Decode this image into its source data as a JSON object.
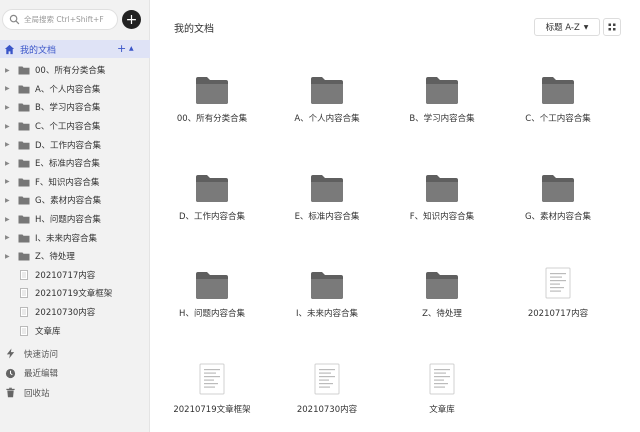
{
  "sidebar": {
    "search_placeholder": "全局搜索 Ctrl+Shift+F",
    "new_button": "+",
    "root": {
      "label": "我的文档",
      "add": "+",
      "caret": "▲"
    },
    "items": [
      {
        "label": "00、所有分类合集",
        "type": "folder"
      },
      {
        "label": "A、个人内容合集",
        "type": "folder"
      },
      {
        "label": "B、学习内容合集",
        "type": "folder"
      },
      {
        "label": "C、个工内容合集",
        "type": "folder"
      },
      {
        "label": "D、工作内容合集",
        "type": "folder"
      },
      {
        "label": "E、标准内容合集",
        "type": "folder"
      },
      {
        "label": "F、知识内容合集",
        "type": "folder"
      },
      {
        "label": "G、素材内容合集",
        "type": "folder"
      },
      {
        "label": "H、问题内容合集",
        "type": "folder"
      },
      {
        "label": "I、未来内容合集",
        "type": "folder"
      },
      {
        "label": "Z、待处理",
        "type": "folder"
      },
      {
        "label": "20210717内容",
        "type": "doc"
      },
      {
        "label": "20210719文章框架",
        "type": "doc"
      },
      {
        "label": "20210730内容",
        "type": "doc"
      },
      {
        "label": "文章库",
        "type": "doc"
      }
    ],
    "bottom": [
      {
        "label": "快速访问",
        "icon": "lightning-icon"
      },
      {
        "label": "最近编辑",
        "icon": "clock-icon"
      },
      {
        "label": "回收站",
        "icon": "trash-icon"
      }
    ]
  },
  "main": {
    "title": "我的文档",
    "sort_label": "标题 A-Z",
    "cards": [
      {
        "label": "00、所有分类合集",
        "type": "folder"
      },
      {
        "label": "A、个人内容合集",
        "type": "folder"
      },
      {
        "label": "B、学习内容合集",
        "type": "folder"
      },
      {
        "label": "C、个工内容合集",
        "type": "folder"
      },
      {
        "label": "D、工作内容合集",
        "type": "folder"
      },
      {
        "label": "E、标准内容合集",
        "type": "folder"
      },
      {
        "label": "F、知识内容合集",
        "type": "folder"
      },
      {
        "label": "G、素材内容合集",
        "type": "folder"
      },
      {
        "label": "H、问题内容合集",
        "type": "folder"
      },
      {
        "label": "I、未来内容合集",
        "type": "folder"
      },
      {
        "label": "Z、待处理",
        "type": "folder"
      },
      {
        "label": "20210717内容",
        "type": "doc"
      },
      {
        "label": "20210719文章框架",
        "type": "doc"
      },
      {
        "label": "20210730内容",
        "type": "doc"
      },
      {
        "label": "文章库",
        "type": "doc"
      }
    ]
  },
  "colors": {
    "accent": "#3a55c8",
    "highlight": "#dfe3f6",
    "folder": "#6e6e6e",
    "sidebar_bg": "#f2f2f2"
  }
}
